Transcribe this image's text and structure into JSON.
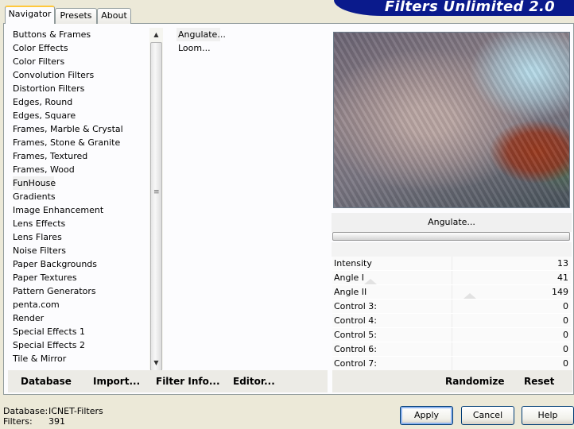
{
  "window": {
    "logo_text": "Filters Unlimited 2.0"
  },
  "tabs": [
    {
      "label": "Navigator",
      "active": true
    },
    {
      "label": "Presets",
      "active": false
    },
    {
      "label": "About",
      "active": false
    }
  ],
  "categories": [
    "Buttons & Frames",
    "Color Effects",
    "Color Filters",
    "Convolution Filters",
    "Distortion Filters",
    "Edges, Round",
    "Edges, Square",
    "Frames, Marble & Crystal",
    "Frames, Stone & Granite",
    "Frames, Textured",
    "Frames, Wood",
    "FunHouse",
    "Gradients",
    "Image Enhancement",
    "Lens Effects",
    "Lens Flares",
    "Noise Filters",
    "Paper Backgrounds",
    "Paper Textures",
    "Pattern Generators",
    "penta.com",
    "Render",
    "Special Effects 1",
    "Special Effects 2",
    "Tile & Mirror"
  ],
  "selected_category": "FunHouse",
  "filters": [
    "Angulate...",
    "Loom..."
  ],
  "selected_filter": "Angulate...",
  "preview": {
    "filter_name": "Angulate..."
  },
  "controls": [
    {
      "label": "Intensity",
      "value": "13"
    },
    {
      "label": "Angle I",
      "value": "41"
    },
    {
      "label": "Angle II",
      "value": "149"
    },
    {
      "label": "Control 3:",
      "value": "0"
    },
    {
      "label": "Control 4:",
      "value": "0"
    },
    {
      "label": "Control 5:",
      "value": "0"
    },
    {
      "label": "Control 6:",
      "value": "0"
    },
    {
      "label": "Control 7:",
      "value": "0"
    }
  ],
  "toolbar": {
    "database": "Database",
    "import": "Import...",
    "filter_info": "Filter Info...",
    "editor": "Editor...",
    "randomize": "Randomize",
    "reset": "Reset"
  },
  "status": {
    "database_label": "Database:",
    "database_value": "ICNET-Filters",
    "filters_label": "Filters:",
    "filters_value": "391"
  },
  "buttons": {
    "apply": "Apply",
    "cancel": "Cancel",
    "help": "Help"
  }
}
